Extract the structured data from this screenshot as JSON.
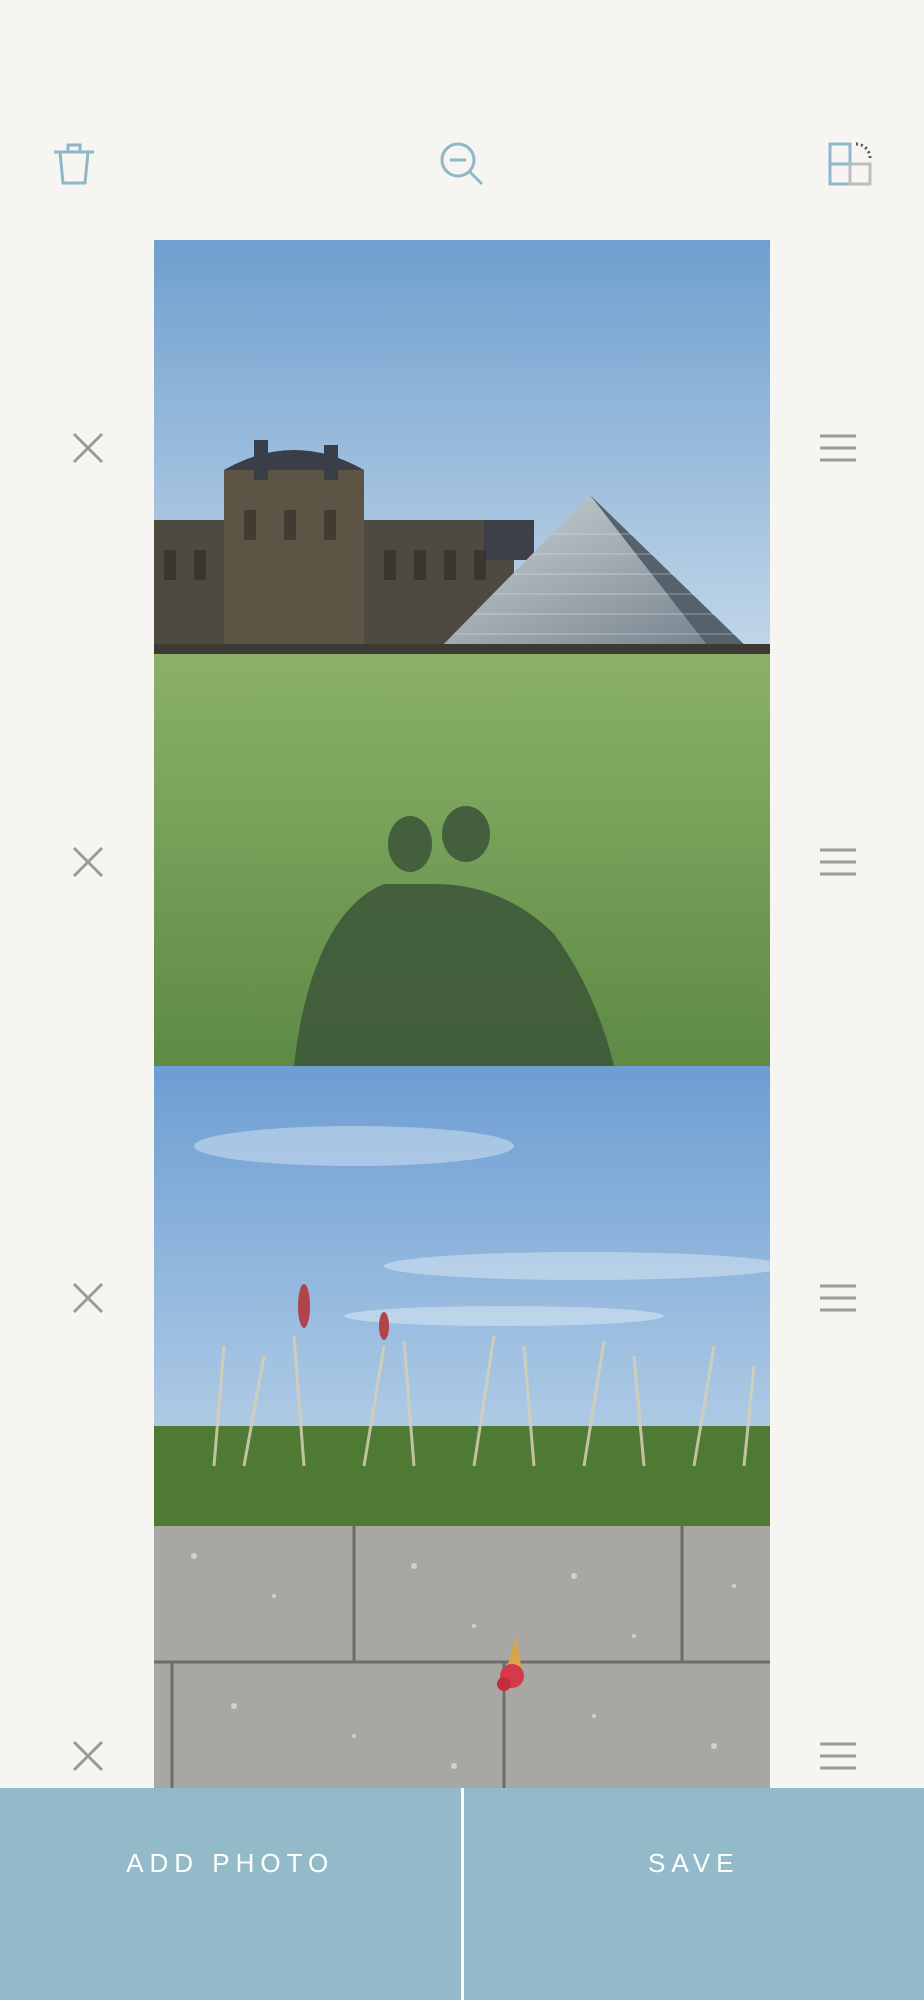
{
  "toolbar": {
    "trash_icon": "trash-icon",
    "zoom_icon": "zoom-out-icon",
    "layout_icon": "layout-grid-icon",
    "icon_color": "#8db8c8"
  },
  "photos": [
    {
      "name": "louvre-pyramid",
      "description_icon": "photo"
    },
    {
      "name": "shadow-on-grass",
      "description_icon": "photo"
    },
    {
      "name": "grass-and-sky",
      "description_icon": "photo"
    },
    {
      "name": "flower-on-pavement",
      "description_icon": "photo"
    }
  ],
  "row_controls": {
    "remove_icon": "close-icon",
    "reorder_icon": "drag-handle-icon",
    "color": "#9a9a9a"
  },
  "actions": {
    "add_photo_label": "ADD PHOTO",
    "save_label": "SAVE",
    "button_color": "#92bac8"
  }
}
